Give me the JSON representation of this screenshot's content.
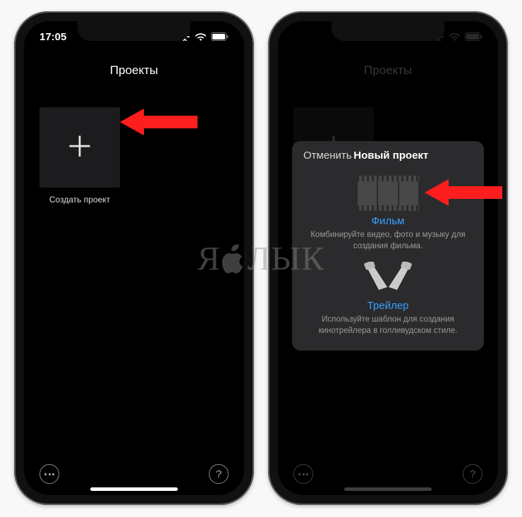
{
  "left": {
    "status_time": "17:05",
    "nav_title": "Проекты",
    "create_caption": "Создать проект"
  },
  "right": {
    "nav_title": "Проекты",
    "sheet": {
      "cancel": "Отменить",
      "title": "Новый проект",
      "movie": {
        "label": "Фильм",
        "desc": "Комбинируйте видео, фото и музыку для создания фильма."
      },
      "trailer": {
        "label": "Трейлер",
        "desc": "Используйте шаблон для создания кинотрейлера в голливудском стиле."
      }
    }
  },
  "watermark": {
    "pre": "Я",
    "post": "ЛЫК"
  }
}
